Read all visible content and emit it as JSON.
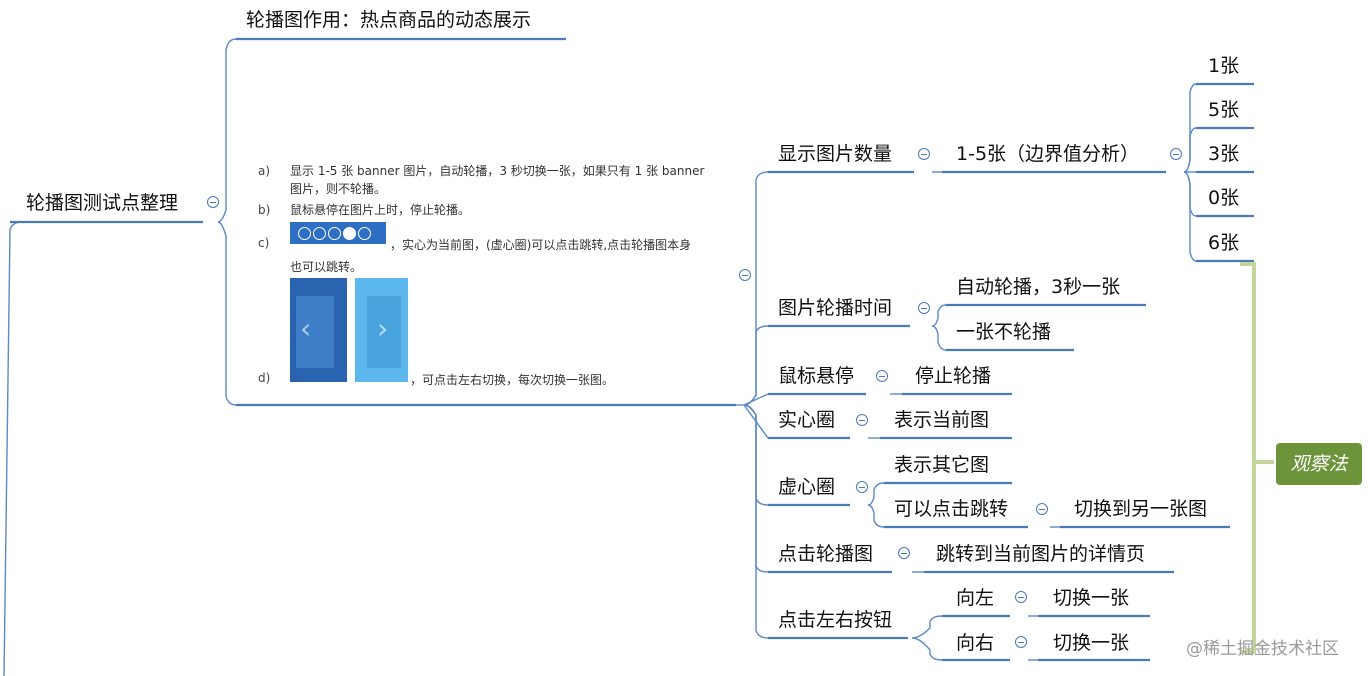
{
  "root": {
    "label": "轮播图测试点整理"
  },
  "purpose": {
    "label": "轮播图作用：热点商品的动态展示"
  },
  "embedded_spec": {
    "items": [
      {
        "marker": "a)",
        "line1": "显示 1-5 张 banner 图片，自动轮播，3 秒切换一张，如果只有 1 张 banner",
        "line2": "图片，则不轮播。"
      },
      {
        "marker": "b)",
        "line1": "鼠标悬停在图片上时，停止轮播。"
      },
      {
        "marker": "c)",
        "line1": "，实心为当前图，(虚心圈)可以点击跳转,点击轮播图本身",
        "line2": "也可以跳转。"
      },
      {
        "marker": "d)",
        "line1": "，可点击左右切换，每次切换一张图。"
      }
    ]
  },
  "branches": {
    "count": {
      "label": "显示图片数量",
      "child": "1-5张（边界值分析）",
      "values": [
        "1张",
        "5张",
        "3张",
        "0张",
        "6张"
      ]
    },
    "interval": {
      "label": "图片轮播时间",
      "children": [
        "自动轮播，3秒一张",
        "一张不轮播"
      ]
    },
    "hover": {
      "label": "鼠标悬停",
      "child": "停止轮播"
    },
    "solid": {
      "label": "实心圈",
      "child": "表示当前图"
    },
    "hollow": {
      "label": "虚心圈",
      "children": [
        "表示其它图",
        "可以点击跳转"
      ],
      "grandchild": "切换到另一张图"
    },
    "click": {
      "label": "点击轮播图",
      "child": "跳转到当前图片的详情页"
    },
    "arrows": {
      "label": "点击左右按钮",
      "children": [
        "向左",
        "向右"
      ],
      "results": [
        "切换一张",
        "切换一张"
      ]
    }
  },
  "summary_tag": "观察法",
  "watermark": "@稀土掘金技术社区",
  "colors": {
    "line": "#5b8ac8",
    "tag": "#6c943a",
    "bracket": "#c5d59a"
  }
}
